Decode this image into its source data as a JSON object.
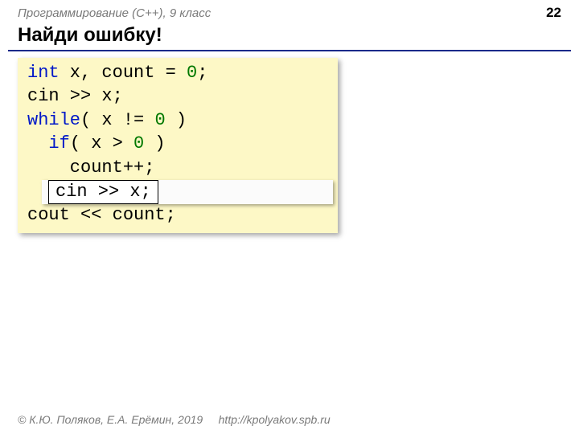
{
  "header": {
    "subject": "Программирование (C++), 9 класс",
    "page_number": "22"
  },
  "title": "Найди ошибку!",
  "code": {
    "l1_kw": "int",
    "l1_rest1": " x, count = ",
    "l1_zero": "0",
    "l1_semi": ";",
    "l2": "cin >> x;",
    "l3_kw": "while",
    "l3_rest1": "( x != ",
    "l3_zero": "0",
    "l3_rest2": " )",
    "l4_kw": "  if",
    "l4_rest1": "( x > ",
    "l4_zero": "0",
    "l4_rest2": " )",
    "l5": "    count++;",
    "l7": "cout << count;"
  },
  "highlight": "cin >> x;",
  "footer": {
    "copyright": "© К.Ю. Поляков, Е.А. Ерёмин, 2019",
    "url": "http://kpolyakov.spb.ru"
  }
}
